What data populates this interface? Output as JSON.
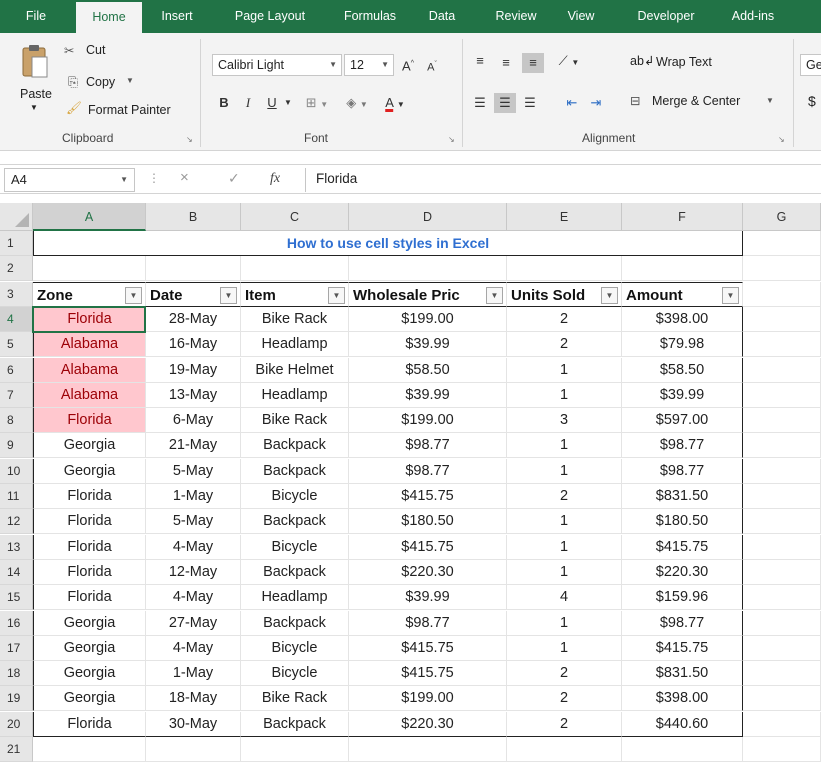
{
  "ribbon_tabs": [
    "File",
    "Home",
    "Insert",
    "Page Layout",
    "Formulas",
    "Data",
    "Review",
    "View",
    "Developer",
    "Add-ins"
  ],
  "active_tab": "Home",
  "clipboard": {
    "paste_label": "Paste",
    "cut_label": "Cut",
    "copy_label": "Copy",
    "format_painter_label": "Format Painter",
    "group_label": "Clipboard"
  },
  "font": {
    "font_name": "Calibri Light",
    "font_size": "12",
    "group_label": "Font",
    "bold": "B",
    "italic": "I",
    "underline": "U",
    "grow": "A",
    "shrink": "A"
  },
  "alignment": {
    "wrap_text_label": "Wrap Text",
    "merge_center_label": "Merge & Center",
    "group_label": "Alignment"
  },
  "number": {
    "format_partial": "Ge",
    "currency_symbol": "$"
  },
  "formula_bar": {
    "name_box": "A4",
    "fx": "fx",
    "cancel": "×",
    "enter": "✓",
    "value": "Florida"
  },
  "columns": [
    "A",
    "B",
    "C",
    "D",
    "E",
    "F",
    "G"
  ],
  "row_numbers": [
    "1",
    "2",
    "3",
    "4",
    "5",
    "6",
    "7",
    "8",
    "9",
    "10",
    "11",
    "12",
    "13",
    "14",
    "15",
    "16",
    "17",
    "18",
    "19",
    "20",
    "21"
  ],
  "sheet": {
    "title": "How to use cell styles in Excel",
    "headers": [
      "Zone",
      "Date",
      "Item",
      "Wholesale Pric",
      "Units Sold",
      "Amount"
    ],
    "rows": [
      {
        "zone": "Florida",
        "date": "28-May",
        "item": "Bike Rack",
        "price": "$199.00",
        "units": "2",
        "amount": "$398.00"
      },
      {
        "zone": "Alabama",
        "date": "16-May",
        "item": "Headlamp",
        "price": "$39.99",
        "units": "2",
        "amount": "$79.98"
      },
      {
        "zone": "Alabama",
        "date": "19-May",
        "item": "Bike Helmet",
        "price": "$58.50",
        "units": "1",
        "amount": "$58.50"
      },
      {
        "zone": "Alabama",
        "date": "13-May",
        "item": "Headlamp",
        "price": "$39.99",
        "units": "1",
        "amount": "$39.99"
      },
      {
        "zone": "Florida",
        "date": "6-May",
        "item": "Bike Rack",
        "price": "$199.00",
        "units": "3",
        "amount": "$597.00"
      },
      {
        "zone": "Georgia",
        "date": "21-May",
        "item": "Backpack",
        "price": "$98.77",
        "units": "1",
        "amount": "$98.77"
      },
      {
        "zone": "Georgia",
        "date": "5-May",
        "item": "Backpack",
        "price": "$98.77",
        "units": "1",
        "amount": "$98.77"
      },
      {
        "zone": "Florida",
        "date": "1-May",
        "item": "Bicycle",
        "price": "$415.75",
        "units": "2",
        "amount": "$831.50"
      },
      {
        "zone": "Florida",
        "date": "5-May",
        "item": "Backpack",
        "price": "$180.50",
        "units": "1",
        "amount": "$180.50"
      },
      {
        "zone": "Florida",
        "date": "4-May",
        "item": "Bicycle",
        "price": "$415.75",
        "units": "1",
        "amount": "$415.75"
      },
      {
        "zone": "Florida",
        "date": "12-May",
        "item": "Backpack",
        "price": "$220.30",
        "units": "1",
        "amount": "$220.30"
      },
      {
        "zone": "Florida",
        "date": "4-May",
        "item": "Headlamp",
        "price": "$39.99",
        "units": "4",
        "amount": "$159.96"
      },
      {
        "zone": "Georgia",
        "date": "27-May",
        "item": "Backpack",
        "price": "$98.77",
        "units": "1",
        "amount": "$98.77"
      },
      {
        "zone": "Georgia",
        "date": "4-May",
        "item": "Bicycle",
        "price": "$415.75",
        "units": "1",
        "amount": "$415.75"
      },
      {
        "zone": "Georgia",
        "date": "1-May",
        "item": "Bicycle",
        "price": "$415.75",
        "units": "2",
        "amount": "$831.50"
      },
      {
        "zone": "Georgia",
        "date": "18-May",
        "item": "Bike Rack",
        "price": "$199.00",
        "units": "2",
        "amount": "$398.00"
      },
      {
        "zone": "Florida",
        "date": "30-May",
        "item": "Backpack",
        "price": "$220.30",
        "units": "2",
        "amount": "$440.60"
      }
    ],
    "highlighted_rows": 5
  },
  "colors": {
    "ribbon_green": "#217346",
    "bad_fill": "#ffc7ce",
    "bad_text": "#9c0006",
    "title_blue": "#2f6fd1"
  }
}
